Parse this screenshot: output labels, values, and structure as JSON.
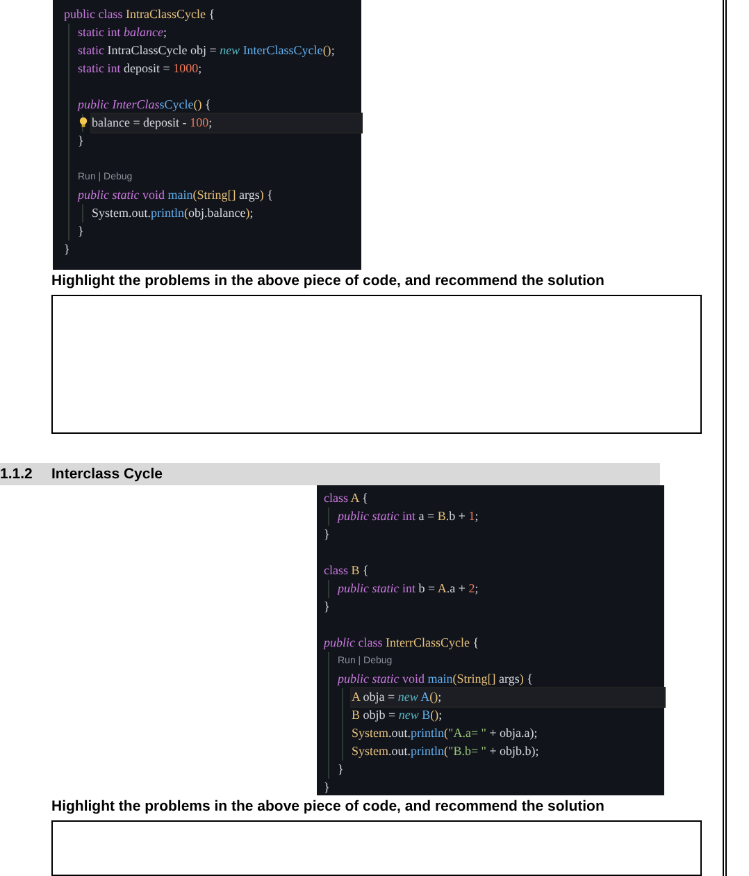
{
  "sections": [
    {
      "kind": "code",
      "lines": [
        {
          "kind": "code",
          "tokens": [
            {
              "kind": "kw",
              "t": "public class "
            },
            {
              "kind": "type",
              "t": "IntraClassCycle"
            },
            {
              "kind": "punc",
              "t": " {"
            }
          ],
          "close": "}",
          "children": [
            {
              "kind": "code",
              "tokens": [
                {
                  "kind": "kw",
                  "t": "static int "
                },
                {
                  "kind": "ikw",
                  "t": "balance"
                },
                {
                  "kind": "plain",
                  "t": ";"
                }
              ]
            },
            {
              "kind": "code",
              "tokens": [
                {
                  "kind": "kw",
                  "t": "static "
                },
                {
                  "kind": "plain",
                  "t": "IntraClassCycle obj = "
                },
                {
                  "kind": "new",
                  "t": "new"
                },
                {
                  "kind": "fn",
                  "t": " InterClassCycle"
                },
                {
                  "kind": "type",
                  "t": "()"
                },
                {
                  "kind": "plain",
                  "t": ";"
                }
              ]
            },
            {
              "kind": "code",
              "tokens": [
                {
                  "kind": "kw",
                  "t": "static int "
                },
                {
                  "kind": "plain",
                  "t": "deposit = "
                },
                {
                  "kind": "num",
                  "t": "1000"
                },
                {
                  "kind": "plain",
                  "t": ";"
                }
              ]
            },
            {
              "kind": "blank"
            },
            {
              "kind": "code",
              "tokens": [
                {
                  "kind": "ikw",
                  "t": "public InterClas"
                },
                {
                  "kind": "fn",
                  "t": "sCycle"
                },
                {
                  "kind": "type",
                  "t": "()"
                },
                {
                  "kind": "punc",
                  "t": " {"
                }
              ],
              "close": "}",
              "children": [
                {
                  "kind": "code",
                  "current": true,
                  "hint": true,
                  "tokens": [
                    {
                      "kind": "plain",
                      "t": "balance = deposit - "
                    },
                    {
                      "kind": "num",
                      "t": "100"
                    },
                    {
                      "kind": "plain",
                      "t": ";"
                    }
                  ]
                }
              ]
            },
            {
              "kind": "blank"
            },
            {
              "kind": "lens",
              "text": "Run | Debug"
            },
            {
              "kind": "code",
              "tokens": [
                {
                  "kind": "ikw",
                  "t": "public static "
                },
                {
                  "kind": "kw",
                  "t": "void "
                },
                {
                  "kind": "fn",
                  "t": "main"
                },
                {
                  "kind": "type",
                  "t": "(String[]"
                },
                {
                  "kind": "plain",
                  "t": " args"
                },
                {
                  "kind": "type",
                  "t": ")"
                },
                {
                  "kind": "punc",
                  "t": " {"
                }
              ],
              "close": "}",
              "children": [
                {
                  "kind": "code",
                  "tokens": [
                    {
                      "kind": "plain",
                      "t": "System.out."
                    },
                    {
                      "kind": "fn",
                      "t": "println"
                    },
                    {
                      "kind": "type",
                      "t": "("
                    },
                    {
                      "kind": "plain",
                      "t": "obj.balance"
                    },
                    {
                      "kind": "type",
                      "t": ")"
                    },
                    {
                      "kind": "plain",
                      "t": ";"
                    }
                  ]
                }
              ]
            }
          ]
        }
      ]
    },
    {
      "kind": "question",
      "text": "Highlight the problems in the above piece of code, and recommend the solution"
    },
    {
      "kind": "answer-box"
    },
    {
      "kind": "heading",
      "number": "1.1.2",
      "text": "Interclass Cycle"
    },
    {
      "kind": "code",
      "lines": [
        {
          "kind": "code",
          "tokens": [
            {
              "kind": "kw",
              "t": "class "
            },
            {
              "kind": "type",
              "t": "A"
            },
            {
              "kind": "punc",
              "t": " {"
            }
          ],
          "close": "}",
          "children": [
            {
              "kind": "code",
              "tokens": [
                {
                  "kind": "ikw",
                  "t": "public static "
                },
                {
                  "kind": "kw",
                  "t": "int "
                },
                {
                  "kind": "plain",
                  "t": "a = "
                },
                {
                  "kind": "type",
                  "t": "B"
                },
                {
                  "kind": "plain",
                  "t": ".b + "
                },
                {
                  "kind": "num",
                  "t": "1"
                },
                {
                  "kind": "plain",
                  "t": ";"
                }
              ]
            }
          ]
        },
        {
          "kind": "blank"
        },
        {
          "kind": "code",
          "tokens": [
            {
              "kind": "kw",
              "t": "class "
            },
            {
              "kind": "type",
              "t": "B"
            },
            {
              "kind": "punc",
              "t": " {"
            }
          ],
          "close": "}",
          "children": [
            {
              "kind": "code",
              "tokens": [
                {
                  "kind": "ikw",
                  "t": "public static "
                },
                {
                  "kind": "kw",
                  "t": "int "
                },
                {
                  "kind": "plain",
                  "t": "b = "
                },
                {
                  "kind": "type",
                  "t": "A"
                },
                {
                  "kind": "plain",
                  "t": ".a + "
                },
                {
                  "kind": "num",
                  "t": "2"
                },
                {
                  "kind": "plain",
                  "t": ";"
                }
              ]
            }
          ]
        },
        {
          "kind": "blank"
        },
        {
          "kind": "code",
          "tokens": [
            {
              "kind": "ikw",
              "t": "public "
            },
            {
              "kind": "kw",
              "t": "class "
            },
            {
              "kind": "type",
              "t": "InterrClassCycle"
            },
            {
              "kind": "punc",
              "t": " {"
            }
          ],
          "close": "}",
          "children": [
            {
              "kind": "lens",
              "text": "Run | Debug"
            },
            {
              "kind": "code",
              "tokens": [
                {
                  "kind": "ikw",
                  "t": "public static "
                },
                {
                  "kind": "kw",
                  "t": "void "
                },
                {
                  "kind": "fn",
                  "t": "main"
                },
                {
                  "kind": "type",
                  "t": "(String[]"
                },
                {
                  "kind": "plain",
                  "t": " args"
                },
                {
                  "kind": "type",
                  "t": ")"
                },
                {
                  "kind": "punc",
                  "t": " {"
                }
              ],
              "close": "}",
              "children": [
                {
                  "kind": "code",
                  "current": true,
                  "tokens": [
                    {
                      "kind": "type",
                      "t": "A"
                    },
                    {
                      "kind": "plain",
                      "t": " obja = "
                    },
                    {
                      "kind": "new",
                      "t": "new"
                    },
                    {
                      "kind": "fn",
                      "t": " A"
                    },
                    {
                      "kind": "type",
                      "t": "()"
                    },
                    {
                      "kind": "plain",
                      "t": ";"
                    }
                  ]
                },
                {
                  "kind": "code",
                  "tokens": [
                    {
                      "kind": "type",
                      "t": "B"
                    },
                    {
                      "kind": "plain",
                      "t": " objb = "
                    },
                    {
                      "kind": "new",
                      "t": "new"
                    },
                    {
                      "kind": "fn",
                      "t": " B"
                    },
                    {
                      "kind": "type",
                      "t": "()"
                    },
                    {
                      "kind": "plain",
                      "t": ";"
                    }
                  ]
                },
                {
                  "kind": "code",
                  "tokens": [
                    {
                      "kind": "type",
                      "t": "System"
                    },
                    {
                      "kind": "plain",
                      "t": ".out."
                    },
                    {
                      "kind": "fn",
                      "t": "println"
                    },
                    {
                      "kind": "type",
                      "t": "("
                    },
                    {
                      "kind": "str",
                      "t": "\"A.a= \""
                    },
                    {
                      "kind": "plain",
                      "t": " + obja.a);"
                    }
                  ]
                },
                {
                  "kind": "code",
                  "tokens": [
                    {
                      "kind": "type",
                      "t": "System"
                    },
                    {
                      "kind": "plain",
                      "t": ".out."
                    },
                    {
                      "kind": "fn",
                      "t": "println"
                    },
                    {
                      "kind": "type",
                      "t": "("
                    },
                    {
                      "kind": "str",
                      "t": "\"B.b= \""
                    },
                    {
                      "kind": "plain",
                      "t": " + objb.b);"
                    }
                  ]
                }
              ]
            }
          ]
        }
      ]
    },
    {
      "kind": "question",
      "text": "Highlight the problems in the above piece of code, and recommend the solution"
    },
    {
      "kind": "answer-box"
    }
  ]
}
